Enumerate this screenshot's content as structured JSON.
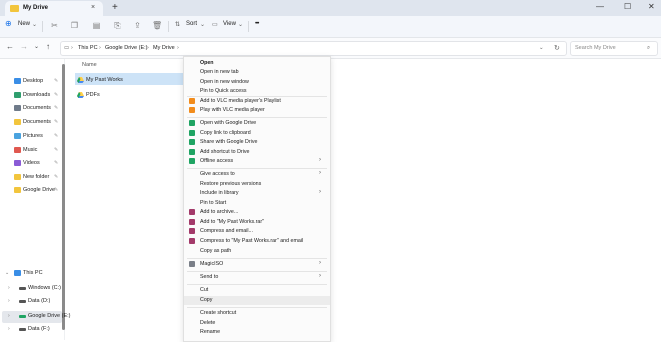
{
  "window": {
    "tab_title": "My Drive",
    "new_tab_symbol": "+",
    "close_tab_symbol": "×",
    "minimize_symbol": "—",
    "maximize_symbol": "☐",
    "close_symbol": "✕"
  },
  "toolbar": {
    "new_label": "New",
    "sort_label": "Sort",
    "view_label": "View",
    "more_symbol": "•••"
  },
  "address": {
    "crumbs": [
      "This PC",
      "Google Drive (E:)",
      "My Drive"
    ],
    "search_placeholder": "Search My Drive"
  },
  "sidebar": {
    "quick_access": [
      {
        "label": "Desktop",
        "color": "#3a8ee6"
      },
      {
        "label": "Downloads",
        "color": "#2f9e6e"
      },
      {
        "label": "Documents",
        "color": "#6f7b8a"
      },
      {
        "label": "Documents",
        "color": "#f2c53d"
      },
      {
        "label": "Pictures",
        "color": "#4aa3df"
      },
      {
        "label": "Music",
        "color": "#e0584f"
      },
      {
        "label": "Videos",
        "color": "#8a5bd6"
      },
      {
        "label": "New folder",
        "color": "#f2c53d"
      },
      {
        "label": "Google Drive",
        "color": "#f2c53d"
      }
    ],
    "this_pc": "This PC",
    "drives": [
      {
        "label": "Windows (C:)"
      },
      {
        "label": "Data (D:)"
      },
      {
        "label": "Google Drive (E:)"
      },
      {
        "label": "Data (F:)"
      }
    ]
  },
  "content": {
    "column_name": "Name",
    "files": [
      {
        "label": "My Past Works"
      },
      {
        "label": "PDFs"
      }
    ]
  },
  "context_menu": {
    "items": [
      {
        "label": "Open",
        "bold": true,
        "icon": "none"
      },
      {
        "label": "Open in new tab",
        "icon": "none"
      },
      {
        "label": "Open in new window",
        "icon": "none"
      },
      {
        "label": "Pin to Quick access",
        "icon": "none"
      },
      {
        "label": "Add to VLC media player's Playlist",
        "icon": "vlc"
      },
      {
        "label": "Play with VLC media player",
        "icon": "vlc"
      },
      {
        "label": "Open with Google Drive",
        "icon": "gdrive"
      },
      {
        "label": "Copy link to clipboard",
        "icon": "gdrive"
      },
      {
        "label": "Share with Google Drive",
        "icon": "gdrive"
      },
      {
        "label": "Add shortcut to Drive",
        "icon": "gdrive"
      },
      {
        "label": "Offline access",
        "icon": "gdrive",
        "submenu": true
      },
      {
        "label": "Give access to",
        "icon": "none",
        "submenu": true
      },
      {
        "label": "Restore previous versions",
        "icon": "none"
      },
      {
        "label": "Include in library",
        "icon": "none",
        "submenu": true
      },
      {
        "label": "Pin to Start",
        "icon": "none"
      },
      {
        "label": "Add to archive...",
        "icon": "winrar"
      },
      {
        "label": "Add to \"My Past Works.rar\"",
        "icon": "winrar"
      },
      {
        "label": "Compress and email...",
        "icon": "winrar"
      },
      {
        "label": "Compress to \"My Past Works.rar\" and email",
        "icon": "winrar"
      },
      {
        "label": "Copy as path",
        "icon": "none"
      },
      {
        "label": "MagicISO",
        "icon": "magiciso",
        "submenu": true
      },
      {
        "label": "Send to",
        "icon": "none",
        "submenu": true
      },
      {
        "label": "Cut",
        "icon": "none"
      },
      {
        "label": "Copy",
        "icon": "none",
        "highlighted": true
      },
      {
        "label": "Create shortcut",
        "icon": "none"
      },
      {
        "label": "Delete",
        "icon": "none"
      },
      {
        "label": "Rename",
        "icon": "none"
      }
    ],
    "submenu_arrow": "›"
  },
  "colors": {
    "selection": "#cde3f7",
    "folder": "#f2c53d",
    "vlc": "#f28c1c",
    "gdrive_green": "#1fa463",
    "gdrive_yellow": "#ffd04b",
    "gdrive_blue": "#4688f4",
    "winrar": "#a33a6a"
  }
}
